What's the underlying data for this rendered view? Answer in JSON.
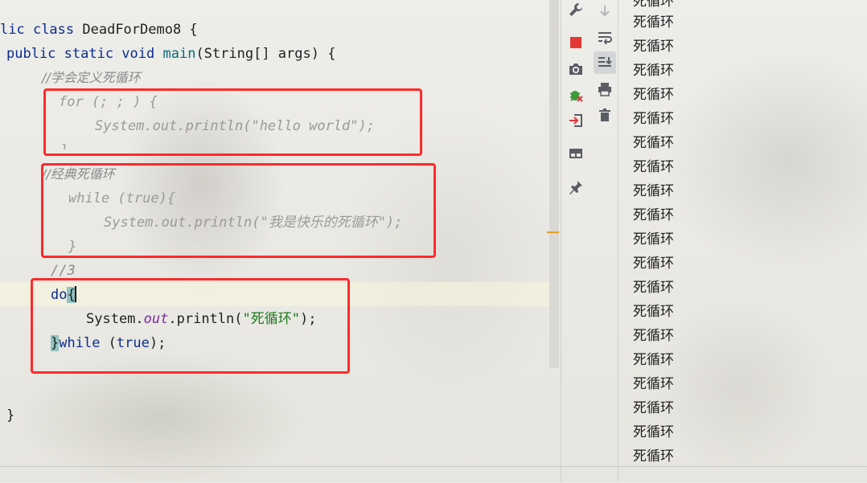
{
  "editor": {
    "lines": {
      "class_decl": {
        "prefix": "lic ",
        "kw_class": "class",
        "name": " DeadForDemo8 {"
      },
      "main_decl": {
        "kw_mods": "public static void",
        "sp": " ",
        "name": "main",
        "rest": "(String[] args) {"
      },
      "comment1": "//学会定义死循环",
      "for_line": "for (; ; ) {",
      "for_body": "System.out.println(\"hello world\");",
      "for_close": "}",
      "comment2": "//经典死循环",
      "while_line": "while (true){",
      "while_body": "System.out.println(\"我是快乐的死循环\");",
      "while_close": "}",
      "comment3": "//3",
      "do_kw": "do",
      "do_brace": "{",
      "dobody_pre": "System.",
      "dobody_field": "out",
      "dobody_mid": ".println(",
      "dobody_str": "\"死循环\"",
      "dobody_end": ");",
      "end_brace": "}",
      "end_kw_while": "while",
      "end_paren_open": " (",
      "end_kw_true": "true",
      "end_paren_close": ");",
      "class_close": "}"
    }
  },
  "console": {
    "lines": [
      "死循环",
      "死循环",
      "死循环",
      "死循环",
      "死循环",
      "死循环",
      "死循环",
      "死循环",
      "死循环",
      "死循环",
      "死循环",
      "死循环",
      "死循环",
      "死循环",
      "死循环",
      "死循环",
      "死循环",
      "死循环",
      "死循环",
      "死循环"
    ]
  },
  "toolbar": {
    "icons": [
      "wrench-icon",
      "stop-icon",
      "camera-icon",
      "debug-bug-icon",
      "login-icon",
      "layout-icon",
      "pin-icon",
      "scroll-down-icon",
      "soft-wrap-icon",
      "scroll-to-end-icon",
      "print-icon",
      "trash-icon"
    ]
  },
  "colors": {
    "highlight_box": "#ff2a2a",
    "keyword": "#0b2d8c",
    "string": "#1c7a1c",
    "method": "#0a6a7a"
  }
}
